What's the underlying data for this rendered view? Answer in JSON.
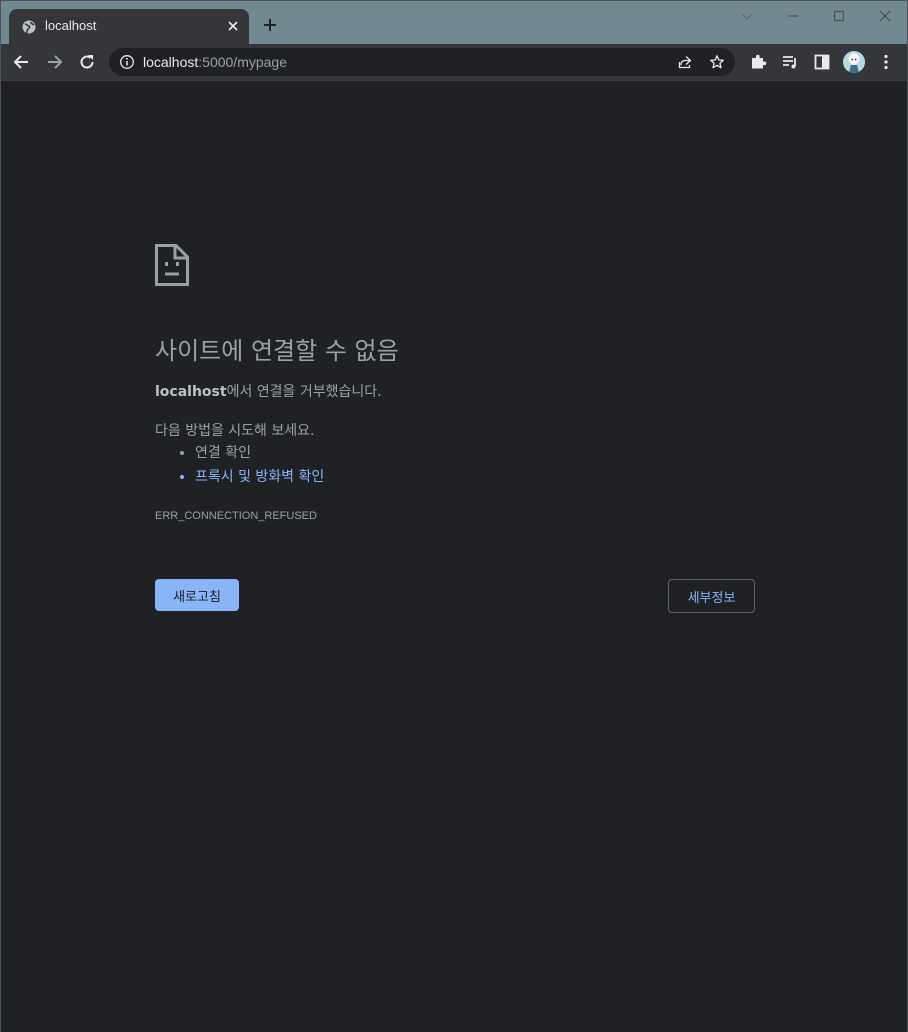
{
  "browser": {
    "tab": {
      "title": "localhost",
      "favicon": "globe-icon"
    },
    "new_tab_icon": "plus-icon",
    "window_controls": [
      "tab-search-icon",
      "minimize-icon",
      "maximize-icon",
      "close-icon"
    ],
    "toolbar": {
      "back_icon": "arrow-left-icon",
      "forward_icon": "arrow-right-icon",
      "reload_icon": "reload-icon",
      "url_host": "localhost",
      "url_rest": ":5000/mypage",
      "share_icon": "share-icon",
      "bookmark_icon": "star-icon",
      "extensions_icon": "puzzle-icon",
      "media_icon": "media-queue-icon",
      "side_panel_icon": "side-panel-icon",
      "menu_icon": "kebab-menu-icon"
    }
  },
  "error_page": {
    "title": "사이트에 연결할 수 없음",
    "host": "localhost",
    "description_suffix": "에서 연결을 거부했습니다.",
    "suggestions_heading": "다음 방법을 시도해 보세요.",
    "suggestions": [
      {
        "text": "연결 확인",
        "is_link": false
      },
      {
        "text": "프록시 및 방화벽 확인",
        "is_link": true
      }
    ],
    "error_code": "ERR_CONNECTION_REFUSED",
    "reload_label": "새로고침",
    "details_label": "세부정보"
  },
  "colors": {
    "page_bg": "#202124",
    "tabstrip_bg": "#718a91",
    "toolbar_bg": "#35363a",
    "text_secondary": "#9aa0a6",
    "accent": "#8ab4f8"
  }
}
